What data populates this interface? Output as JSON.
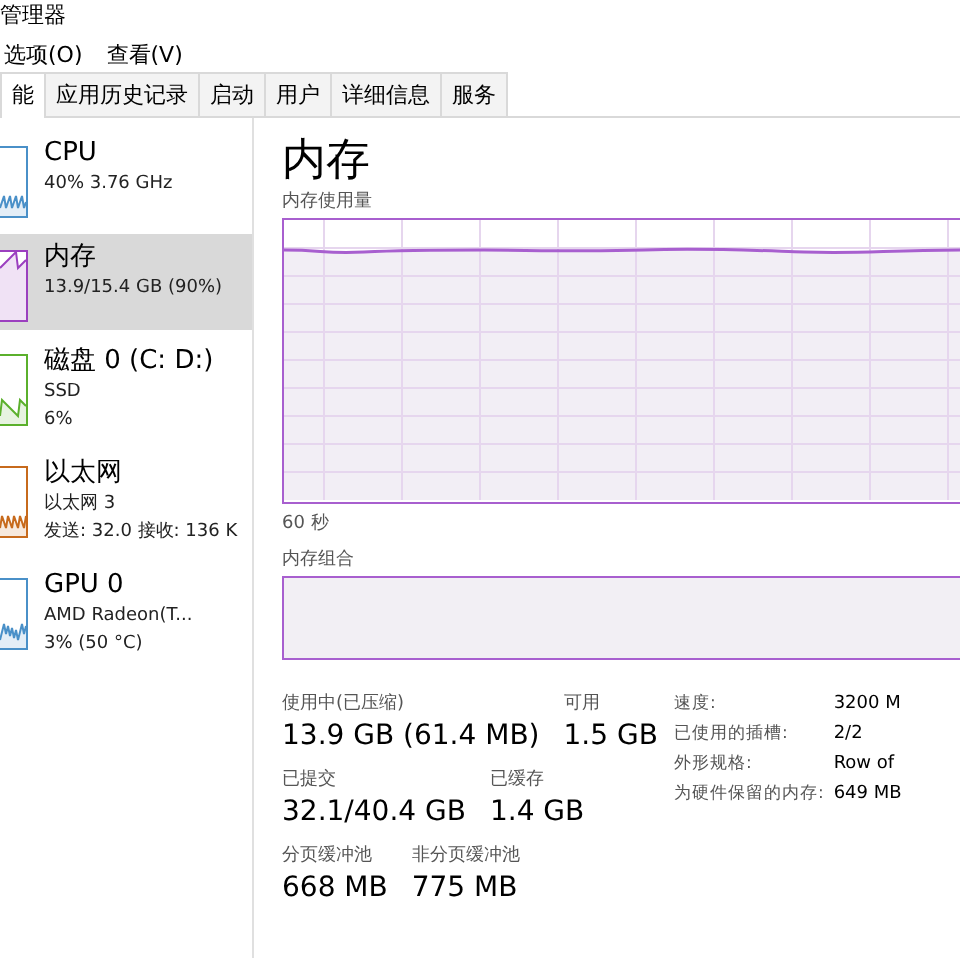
{
  "window": {
    "title": "管理器"
  },
  "menu": [
    "选项(O)",
    "查看(V)"
  ],
  "tabs": [
    {
      "label": "能",
      "selected": true
    },
    {
      "label": "应用历史记录",
      "selected": false
    },
    {
      "label": "启动",
      "selected": false
    },
    {
      "label": "用户",
      "selected": false
    },
    {
      "label": "详细信息",
      "selected": false
    },
    {
      "label": "服务",
      "selected": false
    }
  ],
  "sidebar": {
    "items": [
      {
        "name": "CPU",
        "lines": [
          "40% 3.76 GHz"
        ],
        "color": "#4a90c8",
        "selected": false
      },
      {
        "name": "内存",
        "lines": [
          "13.9/15.4 GB (90%)"
        ],
        "color": "#9b3fbf",
        "selected": true
      },
      {
        "name": "磁盘 0 (C: D:)",
        "lines": [
          "SSD",
          "6%"
        ],
        "color": "#5bb02c",
        "selected": false
      },
      {
        "name": "以太网",
        "lines": [
          "以太网 3",
          "发送: 32.0 接收: 136 K"
        ],
        "color": "#c76a1c",
        "selected": false
      },
      {
        "name": "GPU 0",
        "lines": [
          "AMD Radeon(T...",
          "3% (50 °C)"
        ],
        "color": "#4a90c8",
        "selected": false
      }
    ]
  },
  "main": {
    "title": "内存",
    "usage_label": "内存使用量",
    "time_label": "60 秒",
    "composition_label": "内存组合",
    "stat_rows": [
      [
        {
          "label": "使用中(已压缩)",
          "value": "13.9 GB (61.4 MB)"
        },
        {
          "label": "可用",
          "value": "1.5 GB"
        }
      ],
      [
        {
          "label": "已提交",
          "value": "32.1/40.4 GB"
        },
        {
          "label": "已缓存",
          "value": "1.4 GB"
        }
      ],
      [
        {
          "label": "分页缓冲池",
          "value": "668 MB"
        },
        {
          "label": "非分页缓冲池",
          "value": "775 MB"
        }
      ]
    ],
    "details": [
      {
        "label": "速度:",
        "value": "3200 M"
      },
      {
        "label": "已使用的插槽:",
        "value": "2/2"
      },
      {
        "label": "外形规格:",
        "value": "Row of"
      },
      {
        "label": "为硬件保留的内存:",
        "value": "649 MB"
      }
    ]
  }
}
